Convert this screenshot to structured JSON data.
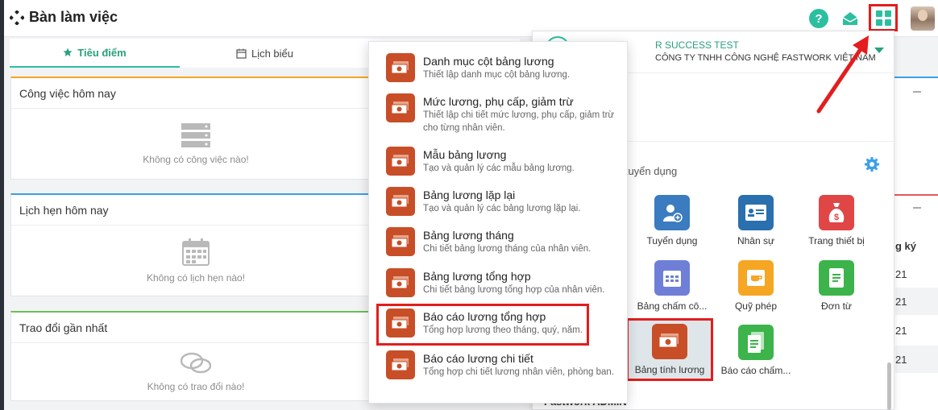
{
  "app": {
    "title": "Bàn làm việc"
  },
  "tabs": [
    {
      "label": "Tiêu điểm",
      "icon": "star-icon",
      "active": true
    },
    {
      "label": "Lịch biểu",
      "icon": "calendar-icon",
      "active": false
    }
  ],
  "cards": {
    "today_tasks": {
      "title": "Công việc hôm nay",
      "empty": "Không có công việc nào!",
      "icon": "server-icon"
    },
    "today_appointments": {
      "title": "Lịch hẹn hôm nay",
      "empty": "Không có lịch hẹn nào!",
      "icon": "calendar-grid-icon"
    },
    "recent_discussions": {
      "title": "Trao đổi gần nhất",
      "empty": "Không có trao đổi nào!",
      "icon": "chat-bubbles-icon"
    }
  },
  "panel": {
    "tenant_name": "R SUCCESS TEST",
    "tenant_company": "CÔNG TY TNHH CÔNG NGHỆ FASTWORK VIỆT NAM",
    "section_label": "a tuyển dụng",
    "bottom_label": "Fastwork ADMIN",
    "modules": [
      {
        "label": "Tuyển dụng",
        "icon": "recruit-icon",
        "color": "#3b7bbf"
      },
      {
        "label": "Nhân sự",
        "icon": "id-card-icon",
        "color": "#2a6fae"
      },
      {
        "label": "Trang thiết bị",
        "icon": "money-bag-icon",
        "color": "#e04646"
      },
      {
        "label": "Bảng chấm cô...",
        "icon": "calendar-check-icon",
        "color": "#6f7fd8"
      },
      {
        "label": "Quỹ phép",
        "icon": "coffee-icon",
        "color": "#f5a623"
      },
      {
        "label": "Đơn từ",
        "icon": "document-icon",
        "color": "#3cb44b"
      },
      {
        "label": "Bảng tính lương",
        "icon": "money-icon",
        "color": "#c84e27"
      },
      {
        "label": "Báo cáo chấm...",
        "icon": "report-icon",
        "color": "#3cb44b"
      }
    ]
  },
  "background_table": {
    "header": "g ký",
    "cells": [
      "21",
      "21",
      "21",
      "21"
    ]
  },
  "dropdown": {
    "items": [
      {
        "title": "Danh mục cột bảng lương",
        "desc": "Thiết lập danh mục cột bảng lương."
      },
      {
        "title": "Mức lương, phụ cấp, giảm trừ",
        "desc": "Thiết lập chi tiết mức lương, phụ cấp, giảm trừ cho từng nhân viên."
      },
      {
        "title": "Mẫu bảng lương",
        "desc": "Tạo và quản lý các mẫu bảng lương."
      },
      {
        "title": "Bảng lương lặp lại",
        "desc": "Tạo và quản lý các bảng lương lặp lại."
      },
      {
        "title": "Bảng lương tháng",
        "desc": "Chi tiết bảng lương tháng của nhân viên."
      },
      {
        "title": "Bảng lương tổng hợp",
        "desc": "Chi tiết bảng lương tổng hợp của nhân viên."
      },
      {
        "title": "Báo cáo lương tổng hợp",
        "desc": "Tổng hợp lương theo tháng, quý, năm."
      },
      {
        "title": "Báo cáo lương chi tiết",
        "desc": "Tổng hợp chi tiết lương nhân viên, phòng ban."
      }
    ]
  },
  "colors": {
    "accent": "#2bbf9f",
    "highlight": "#e31d1d",
    "payroll": "#c84e27"
  }
}
